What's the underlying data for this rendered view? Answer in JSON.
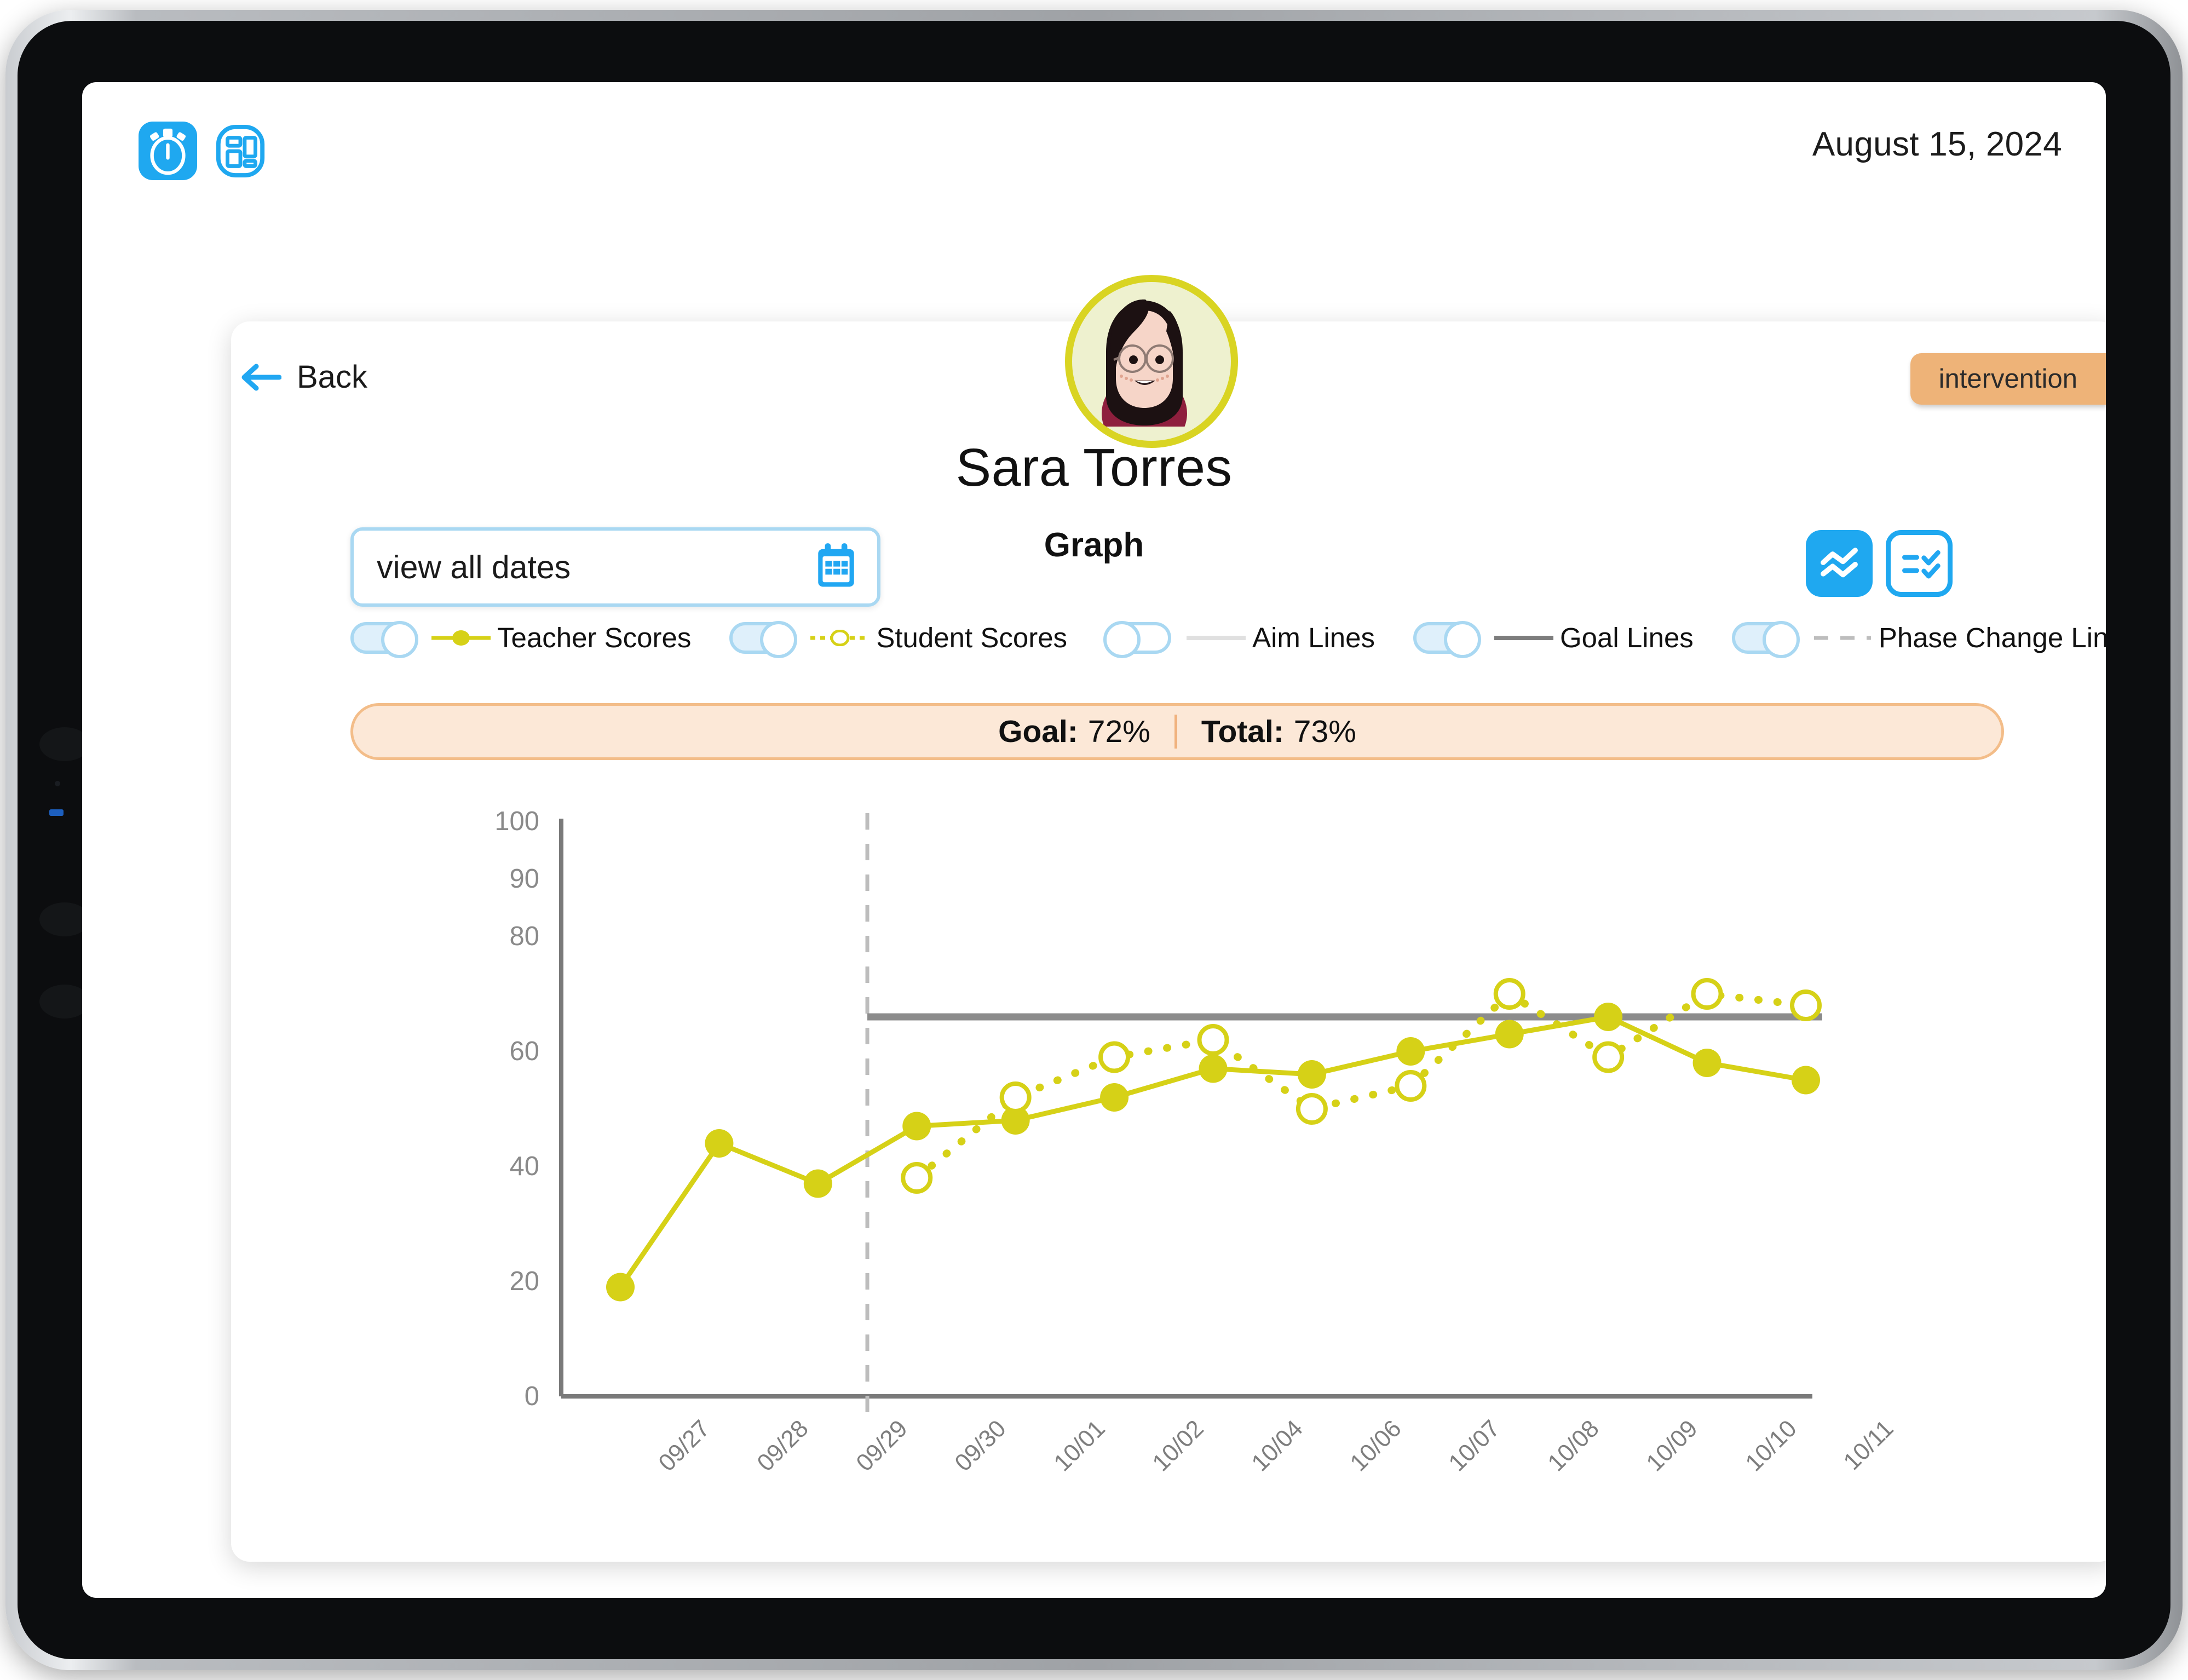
{
  "topbar": {
    "stopwatch_icon": "stopwatch-icon",
    "dashboard_icon": "dashboard-icon",
    "date": "August 15, 2024"
  },
  "card": {
    "back_label": "Back",
    "back_icon": "arrow-left-icon",
    "badge": "intervention",
    "student_name": "Sara Torres",
    "section_title": "Graph",
    "avatar": "student-avatar"
  },
  "date_select": {
    "value": "view all dates",
    "icon": "calendar-icon"
  },
  "view_toggles": [
    {
      "name": "graph-view",
      "icon": "line-chart-icon",
      "active": true
    },
    {
      "name": "list-view",
      "icon": "checklist-icon",
      "active": false
    }
  ],
  "legend": [
    {
      "label": "Teacher Scores",
      "on": true,
      "style": "solid-dot",
      "color": "#d6d117"
    },
    {
      "label": "Student Scores",
      "on": true,
      "style": "dotted-ring",
      "color": "#d6d117"
    },
    {
      "label": "Aim Lines",
      "on": false,
      "style": "line-light",
      "color": "#dedede"
    },
    {
      "label": "Goal Lines",
      "on": true,
      "style": "line-dark",
      "color": "#7d7d7d"
    },
    {
      "label": "Phase Change Lines",
      "on": true,
      "style": "dashed",
      "color": "#b9b9b9"
    }
  ],
  "goal_banner": {
    "goal_label": "Goal:",
    "goal_value": "72%",
    "total_label": "Total:",
    "total_value": "73%"
  },
  "chart_data": {
    "type": "line",
    "title": "Graph",
    "xlabel": "",
    "ylabel": "",
    "ylim": [
      0,
      100
    ],
    "ytick_labels": [
      "100",
      "90",
      "80",
      "60",
      "40",
      "20",
      "0"
    ],
    "ytick_values": [
      100,
      90,
      80,
      60,
      40,
      20,
      0
    ],
    "grid": false,
    "legend_position": "above-chart",
    "categories": [
      "09/27",
      "09/28",
      "09/29",
      "09/30",
      "10/01",
      "10/02",
      "10/04",
      "10/06",
      "10/07",
      "10/08",
      "10/09",
      "10/10",
      "10/11"
    ],
    "series": [
      {
        "name": "Teacher Scores",
        "style": "solid",
        "marker": "filled-circle",
        "color": "#d6d117",
        "values": [
          19,
          44,
          37,
          47,
          48,
          52,
          57,
          56,
          60,
          63,
          66,
          58,
          55
        ]
      },
      {
        "name": "Student Scores",
        "style": "dotted",
        "marker": "open-circle",
        "color": "#d6d117",
        "values": [
          null,
          null,
          null,
          38,
          52,
          59,
          62,
          50,
          54,
          70,
          59,
          70,
          68
        ]
      }
    ],
    "annotations": [
      {
        "type": "goal-line",
        "label": "Goal Lines",
        "value": 66,
        "color": "#8c8c8c",
        "from_category": "09/30",
        "to_category": "10/11"
      },
      {
        "type": "phase-change-line",
        "label": "Phase Change Lines",
        "color": "#bdbdbd",
        "between": [
          "09/29",
          "09/30"
        ]
      }
    ]
  }
}
